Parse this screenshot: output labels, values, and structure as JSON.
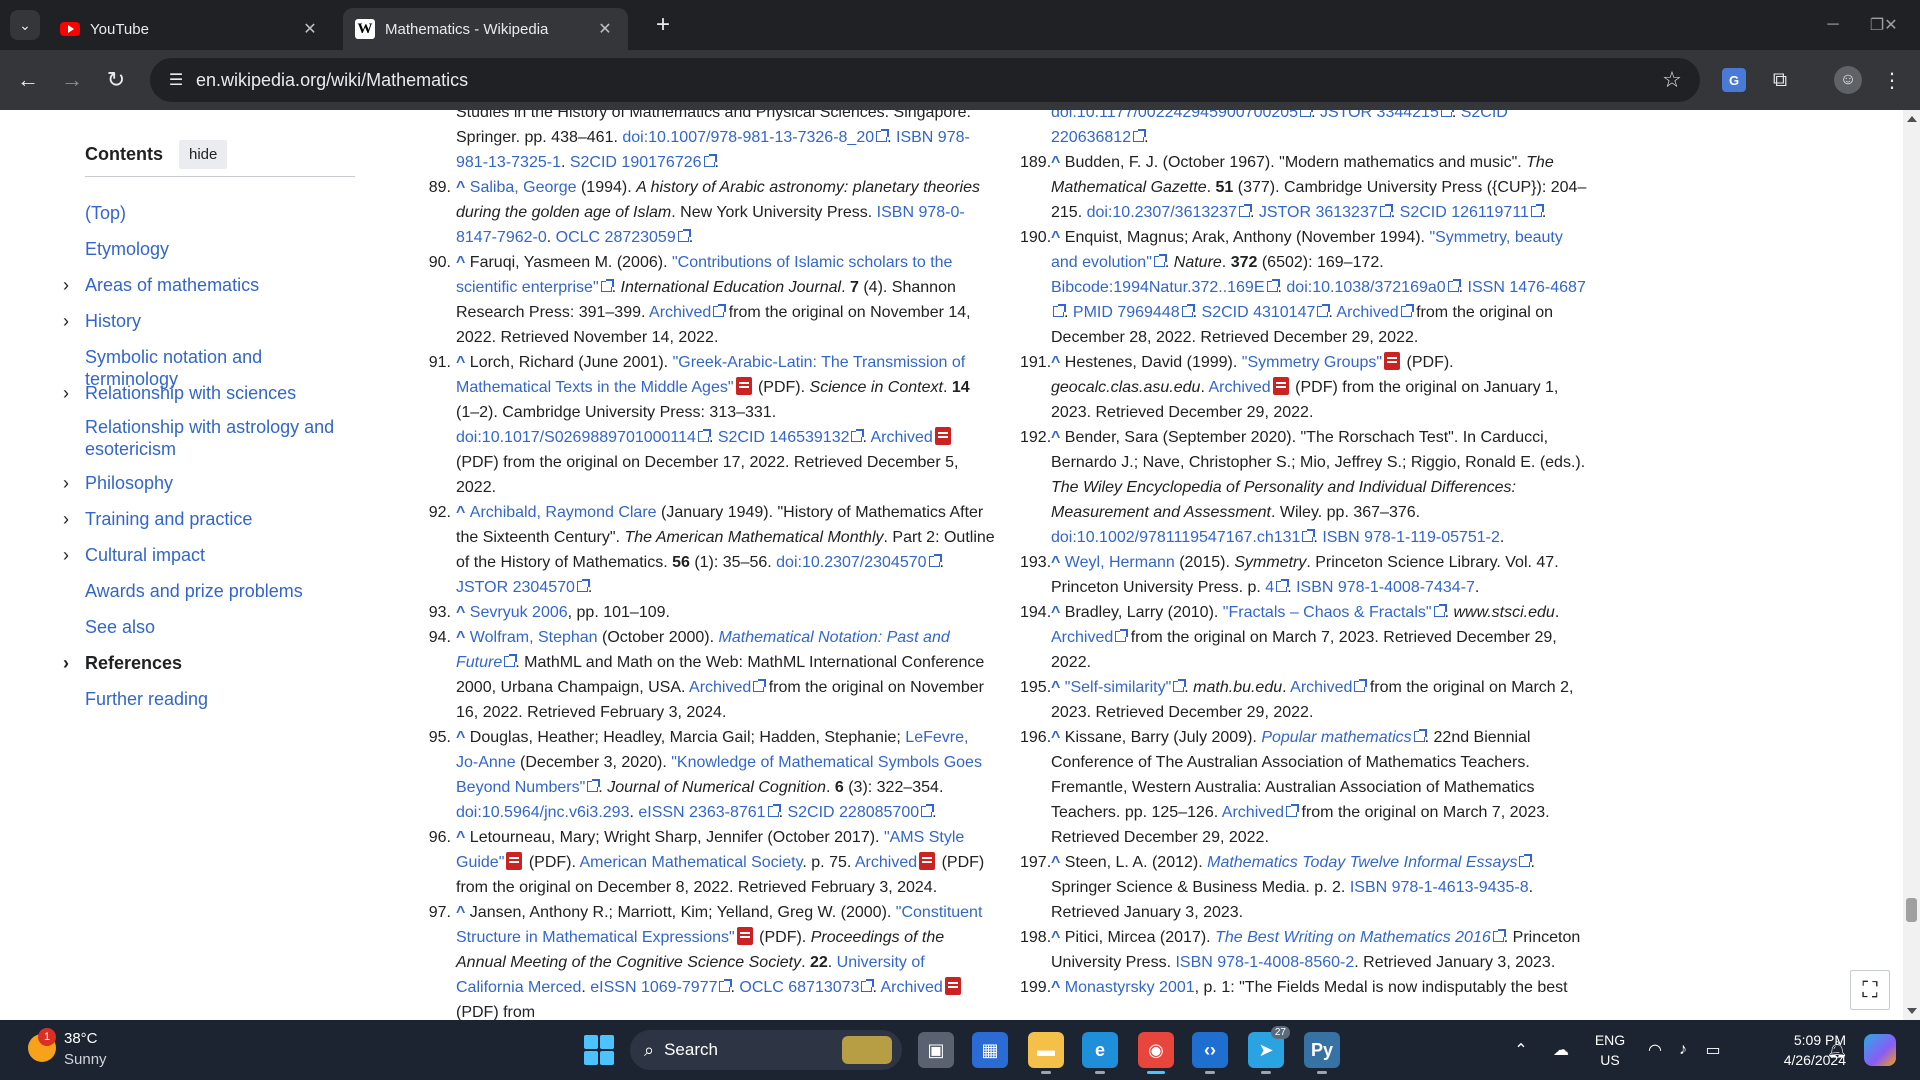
{
  "tabs": [
    {
      "title": "YouTube",
      "favicon": "youtube-icon",
      "active": false
    },
    {
      "title": "Mathematics - Wikipedia",
      "favicon": "wikipedia-icon",
      "active": true
    }
  ],
  "address_bar": {
    "url": "en.wikipedia.org/wiki/Mathematics"
  },
  "toc": {
    "title": "Contents",
    "hide_label": "hide",
    "items": [
      {
        "label": "(Top)",
        "expandable": false
      },
      {
        "label": "Etymology",
        "expandable": false
      },
      {
        "label": "Areas of mathematics",
        "expandable": true
      },
      {
        "label": "History",
        "expandable": true
      },
      {
        "label": "Symbolic notation and terminology",
        "expandable": false
      },
      {
        "label": "Relationship with sciences",
        "expandable": true
      },
      {
        "label": "Relationship with astrology and esotericism",
        "expandable": false
      },
      {
        "label": "Philosophy",
        "expandable": true
      },
      {
        "label": "Training and practice",
        "expandable": true
      },
      {
        "label": "Cultural impact",
        "expandable": true
      },
      {
        "label": "Awards and prize problems",
        "expandable": false
      },
      {
        "label": "See also",
        "expandable": false
      },
      {
        "label": "References",
        "expandable": true,
        "current": true
      },
      {
        "label": "Further reading",
        "expandable": false
      }
    ]
  },
  "refs_left": [
    {
      "num": "",
      "segments": [
        {
          "t": "Studies in the History of Mathematics and Physical Sciences. Singapore: Springer. pp. 438–461. "
        },
        {
          "t": "doi:10.1007/978-981-13-7326-8_20",
          "link": true,
          "ext": true
        },
        {
          "t": ". "
        },
        {
          "t": "ISBN 978-981-13-7325-1",
          "link": true
        },
        {
          "t": ". "
        },
        {
          "t": "S2CID 190176726",
          "link": true,
          "ext": true
        },
        {
          "t": "."
        }
      ]
    },
    {
      "num": "89.",
      "segments": [
        {
          "t": "^ ",
          "caret": true
        },
        {
          "t": "Saliba, George",
          "link": true
        },
        {
          "t": " (1994). "
        },
        {
          "t": "A history of Arabic astronomy: planetary theories during the golden age of Islam",
          "i": true
        },
        {
          "t": ". New York University Press. "
        },
        {
          "t": "ISBN 978-0-8147-7962-0",
          "link": true
        },
        {
          "t": ". "
        },
        {
          "t": "OCLC 28723059",
          "link": true,
          "ext": true
        },
        {
          "t": "."
        }
      ]
    },
    {
      "num": "90.",
      "segments": [
        {
          "t": "^ ",
          "caret": true
        },
        {
          "t": "Faruqi, Yasmeen M. (2006). "
        },
        {
          "t": "\"Contributions of Islamic scholars to the scientific enterprise\"",
          "link": true,
          "ext": true
        },
        {
          "t": ". "
        },
        {
          "t": "International Education Journal",
          "i": true
        },
        {
          "t": ". "
        },
        {
          "t": "7",
          "b": true
        },
        {
          "t": " (4). Shannon Research Press: 391–399. "
        },
        {
          "t": "Archived",
          "link": true,
          "ext": true
        },
        {
          "t": " from the original on November 14, 2022. Retrieved November 14, 2022."
        }
      ]
    },
    {
      "num": "91.",
      "segments": [
        {
          "t": "^ ",
          "caret": true
        },
        {
          "t": "Lorch, Richard (June 2001). "
        },
        {
          "t": "\"Greek-Arabic-Latin: The Transmission of Mathematical Texts in the Middle Ages\"",
          "link": true,
          "pdf": true
        },
        {
          "t": " (PDF). "
        },
        {
          "t": "Science in Context",
          "i": true
        },
        {
          "t": ". "
        },
        {
          "t": "14",
          "b": true
        },
        {
          "t": " (1–2). Cambridge University Press: 313–331. "
        },
        {
          "t": "doi:10.1017/S0269889701000114",
          "link": true,
          "ext": true
        },
        {
          "t": ". "
        },
        {
          "t": "S2CID 146539132",
          "link": true,
          "ext": true
        },
        {
          "t": ". "
        },
        {
          "t": "Archived",
          "link": true,
          "pdf": true
        },
        {
          "t": " (PDF) from the original on December 17, 2022. Retrieved December 5, 2022."
        }
      ]
    },
    {
      "num": "92.",
      "segments": [
        {
          "t": "^ ",
          "caret": true
        },
        {
          "t": "Archibald, Raymond Clare",
          "link": true
        },
        {
          "t": " (January 1949). \"History of Mathematics After the Sixteenth Century\". "
        },
        {
          "t": "The American Mathematical Monthly",
          "i": true
        },
        {
          "t": ". Part 2: Outline of the History of Mathematics. "
        },
        {
          "t": "56",
          "b": true
        },
        {
          "t": " (1): 35–56. "
        },
        {
          "t": "doi:10.2307/2304570",
          "link": true,
          "ext": true
        },
        {
          "t": ". "
        },
        {
          "t": "JSTOR 2304570",
          "link": true,
          "ext": true
        },
        {
          "t": "."
        }
      ]
    },
    {
      "num": "93.",
      "segments": [
        {
          "t": "^ ",
          "caret": true
        },
        {
          "t": "Sevryuk 2006",
          "link": true
        },
        {
          "t": ", pp. 101–109."
        }
      ]
    },
    {
      "num": "94.",
      "segments": [
        {
          "t": "^ ",
          "caret": true
        },
        {
          "t": "Wolfram, Stephan",
          "link": true
        },
        {
          "t": " (October 2000). "
        },
        {
          "t": "Mathematical Notation: Past and Future",
          "link": true,
          "i": true,
          "ext": true
        },
        {
          "t": ". MathML and Math on the Web: MathML International Conference 2000, Urbana Champaign, USA. "
        },
        {
          "t": "Archived",
          "link": true,
          "ext": true
        },
        {
          "t": " from the original on November 16, 2022. Retrieved February 3, 2024."
        }
      ]
    },
    {
      "num": "95.",
      "segments": [
        {
          "t": "^ ",
          "caret": true
        },
        {
          "t": "Douglas, Heather; Headley, Marcia Gail; Hadden, Stephanie; "
        },
        {
          "t": "LeFevre, Jo-Anne",
          "link": true
        },
        {
          "t": " (December 3, 2020). "
        },
        {
          "t": "\"Knowledge of Mathematical Symbols Goes Beyond Numbers\"",
          "link": true,
          "ext": true
        },
        {
          "t": ". "
        },
        {
          "t": "Journal of Numerical Cognition",
          "i": true
        },
        {
          "t": ". "
        },
        {
          "t": "6",
          "b": true
        },
        {
          "t": " (3): 322–354. "
        },
        {
          "t": "doi:10.5964/jnc.v6i3.293",
          "link": true
        },
        {
          "t": ". "
        },
        {
          "t": "eISSN 2363-8761",
          "link": true,
          "ext": true
        },
        {
          "t": ". "
        },
        {
          "t": "S2CID 228085700",
          "link": true,
          "ext": true
        },
        {
          "t": "."
        }
      ]
    },
    {
      "num": "96.",
      "segments": [
        {
          "t": "^ ",
          "caret": true
        },
        {
          "t": "Letourneau, Mary; Wright Sharp, Jennifer (October 2017). "
        },
        {
          "t": "\"AMS Style Guide\"",
          "link": true,
          "pdf": true
        },
        {
          "t": " (PDF). "
        },
        {
          "t": "American Mathematical Society",
          "link": true
        },
        {
          "t": ". p. 75. "
        },
        {
          "t": "Archived",
          "link": true,
          "pdf": true
        },
        {
          "t": " (PDF) from the original on December 8, 2022. Retrieved February 3, 2024."
        }
      ]
    },
    {
      "num": "97.",
      "segments": [
        {
          "t": "^ ",
          "caret": true
        },
        {
          "t": "Jansen, Anthony R.; Marriott, Kim; Yelland, Greg W. (2000). "
        },
        {
          "t": "\"Constituent Structure in Mathematical Expressions\"",
          "link": true,
          "pdf": true
        },
        {
          "t": " (PDF). "
        },
        {
          "t": "Proceedings of the Annual Meeting of the Cognitive Science Society",
          "i": true
        },
        {
          "t": ". "
        },
        {
          "t": "22",
          "b": true
        },
        {
          "t": ". "
        },
        {
          "t": "University of California Merced",
          "link": true
        },
        {
          "t": ". "
        },
        {
          "t": "eISSN 1069-7977",
          "link": true,
          "ext": true
        },
        {
          "t": ". "
        },
        {
          "t": "OCLC 68713073",
          "link": true,
          "ext": true
        },
        {
          "t": ". "
        },
        {
          "t": "Archived",
          "link": true,
          "pdf": true
        },
        {
          "t": " (PDF) from"
        }
      ]
    }
  ],
  "refs_right": [
    {
      "num": "",
      "segments": [
        {
          "t": "doi:10.1177/002242945900700205",
          "link": true,
          "ext": true
        },
        {
          "t": ". "
        },
        {
          "t": "JSTOR 3344215",
          "link": true,
          "ext": true
        },
        {
          "t": ". "
        },
        {
          "t": "S2CID 220636812",
          "link": true,
          "ext": true
        },
        {
          "t": "."
        }
      ]
    },
    {
      "num": "189.",
      "segments": [
        {
          "t": "^ ",
          "caret": true
        },
        {
          "t": "Budden, F. J. (October 1967). \"Modern mathematics and music\". "
        },
        {
          "t": "The Mathematical Gazette",
          "i": true
        },
        {
          "t": ". "
        },
        {
          "t": "51",
          "b": true
        },
        {
          "t": " (377). Cambridge University Press ({CUP}): 204–215. "
        },
        {
          "t": "doi:10.2307/3613237",
          "link": true,
          "ext": true
        },
        {
          "t": ". "
        },
        {
          "t": "JSTOR 3613237",
          "link": true,
          "ext": true
        },
        {
          "t": ". "
        },
        {
          "t": "S2CID 126119711",
          "link": true,
          "ext": true
        },
        {
          "t": "."
        }
      ]
    },
    {
      "num": "190.",
      "segments": [
        {
          "t": "^ ",
          "caret": true
        },
        {
          "t": "Enquist, Magnus; Arak, Anthony (November 1994). "
        },
        {
          "t": "\"Symmetry, beauty and evolution\"",
          "link": true,
          "ext": true
        },
        {
          "t": ". "
        },
        {
          "t": "Nature",
          "i": true
        },
        {
          "t": ". "
        },
        {
          "t": "372",
          "b": true
        },
        {
          "t": " (6502): 169–172. "
        },
        {
          "t": "Bibcode:1994Natur.372..169E",
          "link": true,
          "ext": true
        },
        {
          "t": ". "
        },
        {
          "t": "doi:10.1038/372169a0",
          "link": true,
          "ext": true
        },
        {
          "t": ". "
        },
        {
          "t": "ISSN 1476-4687",
          "link": true,
          "ext": true
        },
        {
          "t": ". "
        },
        {
          "t": "PMID 7969448",
          "link": true,
          "ext": true
        },
        {
          "t": ". "
        },
        {
          "t": "S2CID 4310147",
          "link": true,
          "ext": true
        },
        {
          "t": ". "
        },
        {
          "t": "Archived",
          "link": true,
          "ext": true
        },
        {
          "t": " from the original on December 28, 2022. Retrieved December 29, 2022."
        }
      ]
    },
    {
      "num": "191.",
      "segments": [
        {
          "t": "^ ",
          "caret": true
        },
        {
          "t": "Hestenes, David (1999). "
        },
        {
          "t": "\"Symmetry Groups\"",
          "link": true,
          "pdf": true
        },
        {
          "t": " (PDF). "
        },
        {
          "t": "geocalc.clas.asu.edu",
          "i": true
        },
        {
          "t": ". "
        },
        {
          "t": "Archived",
          "link": true,
          "pdf": true
        },
        {
          "t": " (PDF) from the original on January 1, 2023. Retrieved December 29, 2022."
        }
      ]
    },
    {
      "num": "192.",
      "segments": [
        {
          "t": "^ ",
          "caret": true
        },
        {
          "t": "Bender, Sara (September 2020). \"The Rorschach Test\". In Carducci, Bernardo J.; Nave, Christopher S.; Mio, Jeffrey S.; Riggio, Ronald E. (eds.). "
        },
        {
          "t": "The Wiley Encyclopedia of Personality and Individual Differences: Measurement and Assessment",
          "i": true
        },
        {
          "t": ". Wiley. pp. 367–376. "
        },
        {
          "t": "doi:10.1002/9781119547167.ch131",
          "link": true,
          "ext": true
        },
        {
          "t": ". "
        },
        {
          "t": "ISBN 978-1-119-05751-2",
          "link": true
        },
        {
          "t": "."
        }
      ]
    },
    {
      "num": "193.",
      "segments": [
        {
          "t": "^ ",
          "caret": true
        },
        {
          "t": "Weyl, Hermann",
          "link": true
        },
        {
          "t": " (2015). "
        },
        {
          "t": "Symmetry",
          "i": true
        },
        {
          "t": ". Princeton Science Library. Vol. 47. Princeton University Press. p. "
        },
        {
          "t": "4",
          "link": true,
          "ext": true
        },
        {
          "t": ". "
        },
        {
          "t": "ISBN 978-1-4008-7434-7",
          "link": true
        },
        {
          "t": "."
        }
      ]
    },
    {
      "num": "194.",
      "segments": [
        {
          "t": "^ ",
          "caret": true
        },
        {
          "t": "Bradley, Larry (2010). "
        },
        {
          "t": "\"Fractals – Chaos & Fractals\"",
          "link": true,
          "ext": true
        },
        {
          "t": ". "
        },
        {
          "t": "www.stsci.edu",
          "i": true
        },
        {
          "t": ". "
        },
        {
          "t": "Archived",
          "link": true,
          "ext": true
        },
        {
          "t": " from the original on March 7, 2023. Retrieved December 29, 2022."
        }
      ]
    },
    {
      "num": "195.",
      "segments": [
        {
          "t": "^ ",
          "caret": true
        },
        {
          "t": "\"Self-similarity\"",
          "link": true,
          "ext": true
        },
        {
          "t": ". "
        },
        {
          "t": "math.bu.edu",
          "i": true
        },
        {
          "t": ". "
        },
        {
          "t": "Archived",
          "link": true,
          "ext": true
        },
        {
          "t": " from the original on March 2, 2023. Retrieved December 29, 2022."
        }
      ]
    },
    {
      "num": "196.",
      "segments": [
        {
          "t": "^ ",
          "caret": true
        },
        {
          "t": "Kissane, Barry (July 2009). "
        },
        {
          "t": "Popular mathematics",
          "link": true,
          "i": true,
          "ext": true
        },
        {
          "t": ". 22nd Biennial Conference of The Australian Association of Mathematics Teachers. Fremantle, Western Australia: Australian Association of Mathematics Teachers. pp. 125–126. "
        },
        {
          "t": "Archived",
          "link": true,
          "ext": true
        },
        {
          "t": " from the original on March 7, 2023. Retrieved December 29, 2022."
        }
      ]
    },
    {
      "num": "197.",
      "segments": [
        {
          "t": "^ ",
          "caret": true
        },
        {
          "t": "Steen, L. A. (2012). "
        },
        {
          "t": "Mathematics Today Twelve Informal Essays",
          "link": true,
          "i": true,
          "ext": true
        },
        {
          "t": ". Springer Science & Business Media. p. 2. "
        },
        {
          "t": "ISBN 978-1-4613-9435-8",
          "link": true
        },
        {
          "t": ". Retrieved January 3, 2023."
        }
      ]
    },
    {
      "num": "198.",
      "segments": [
        {
          "t": "^ ",
          "caret": true
        },
        {
          "t": "Pitici, Mircea (2017). "
        },
        {
          "t": "The Best Writing on Mathematics 2016",
          "link": true,
          "i": true,
          "ext": true
        },
        {
          "t": ". Princeton University Press. "
        },
        {
          "t": "ISBN 978-1-4008-8560-2",
          "link": true
        },
        {
          "t": ". Retrieved January 3, 2023."
        }
      ]
    },
    {
      "num": "199.",
      "segments": [
        {
          "t": "^ ",
          "caret": true
        },
        {
          "t": "Monastyrsky 2001",
          "link": true
        },
        {
          "t": ", p. 1: \"The Fields Medal is now indisputably the best"
        }
      ]
    }
  ],
  "taskbar": {
    "weather": {
      "temp": "38°C",
      "desc": "Sunny",
      "badge": "1"
    },
    "search_label": "Search",
    "apps": [
      {
        "name": "task-view",
        "icon": "task-view-icon"
      },
      {
        "name": "microsoft-store",
        "icon": "store-icon"
      },
      {
        "name": "file-explorer",
        "icon": "folder-icon"
      },
      {
        "name": "microsoft-edge",
        "icon": "edge-icon"
      },
      {
        "name": "google-chrome",
        "icon": "chrome-icon"
      },
      {
        "name": "visual-studio-code",
        "icon": "vscode-icon"
      },
      {
        "name": "telegram",
        "icon": "telegram-icon",
        "badge": "27"
      },
      {
        "name": "python",
        "icon": "python-icon"
      }
    ],
    "lang": [
      "ENG",
      "US"
    ],
    "time": "5:09 PM",
    "date": "4/26/2024"
  }
}
